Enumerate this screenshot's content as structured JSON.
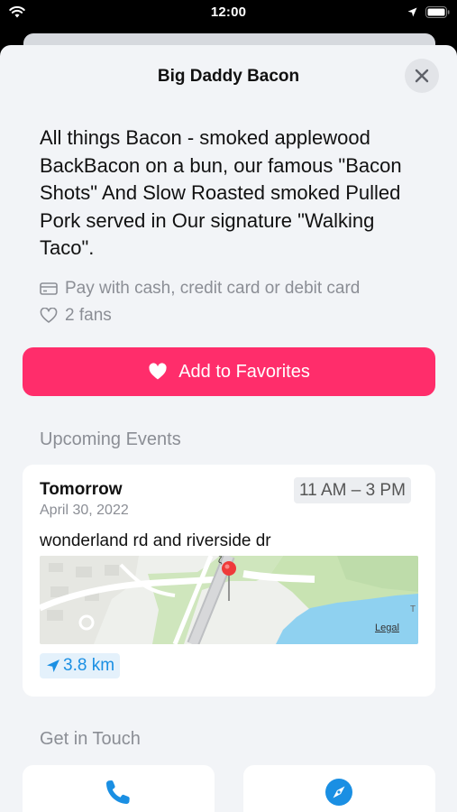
{
  "status_bar": {
    "time": "12:00"
  },
  "header": {
    "title": "Big Daddy Bacon"
  },
  "vendor": {
    "description": "All things Bacon - smoked applewood BackBacon on a bun, our famous \"Bacon Shots\" And Slow Roasted smoked Pulled Pork served in Our signature \"Walking Taco\".",
    "payment": "Pay with cash, credit card or debit card",
    "fans": "2 fans"
  },
  "favorites": {
    "label": "Add to Favorites",
    "color": "#ff2d6b"
  },
  "events": {
    "section_title": "Upcoming Events",
    "items": [
      {
        "day": "Tomorrow",
        "date": "April 30, 2022",
        "time": "11 AM – 3 PM",
        "location": "wonderland rd and riverside dr",
        "map_legal": "Legal",
        "distance": "3.8 km"
      }
    ]
  },
  "contact": {
    "section_title": "Get in Touch",
    "buttons": [
      {
        "icon": "phone-icon"
      },
      {
        "icon": "compass-icon"
      }
    ]
  },
  "colors": {
    "accent": "#1a8fe3",
    "background": "#f2f4f7"
  }
}
